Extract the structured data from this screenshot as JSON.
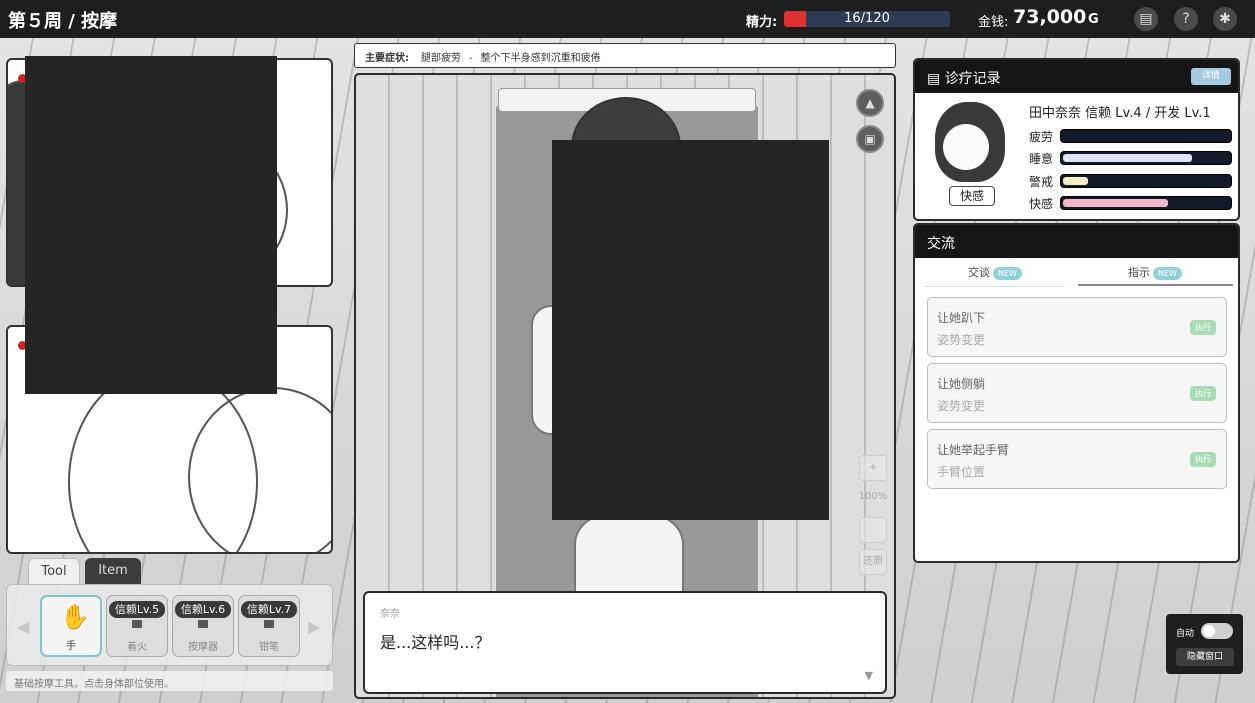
{
  "topbar": {
    "title": "第５周 / 按摩",
    "stamina_label": "精力:",
    "stamina_value": "16/120",
    "stamina_fraction": 0.133,
    "money_label": "金钱:",
    "money_value": "73,000",
    "money_unit": "G",
    "icons": [
      "chat-icon",
      "help-icon",
      "settings-icon"
    ]
  },
  "tools": {
    "tabs": [
      "Tool",
      "Item"
    ],
    "slots": [
      {
        "label": "手",
        "icon": "hand-icon",
        "locked": false
      },
      {
        "badge": "信赖Lv.5",
        "label": "着火",
        "locked": true
      },
      {
        "badge": "信赖Lv.6",
        "label": "按摩器",
        "locked": true
      },
      {
        "badge": "信赖Lv.7",
        "label": "钳笔",
        "locked": true
      }
    ],
    "hint": "基础按摩工具。点击身体部位使用。"
  },
  "symptom": {
    "label": "主要症状:",
    "part": "腿部疲劳",
    "separator": "-",
    "desc": "整个下半身感到沉重和疲倦"
  },
  "stage": {
    "zoom_plus": "+",
    "zoom_level": "100%",
    "zoom_reset": "还原"
  },
  "dialog": {
    "speaker": "奈奈",
    "text": "是...这样吗...？"
  },
  "record": {
    "title": "诊疗记录",
    "button": "详情",
    "name_line": "田中奈奈 信赖 Lv.4 / 开发 Lv.1",
    "tag": "快感",
    "stats": [
      {
        "label": "疲劳",
        "value": 0.0,
        "color": "#1a2236"
      },
      {
        "label": "睡意",
        "value": 0.78,
        "color": "#dde6f6"
      },
      {
        "label": "警戒",
        "value": 0.15,
        "color": "#f3edc8"
      },
      {
        "label": "快感",
        "value": 0.63,
        "color": "#f1b7c6"
      }
    ]
  },
  "comm": {
    "title": "交流",
    "tabs": [
      {
        "label": "交谈",
        "badge": "NEW"
      },
      {
        "label": "指示",
        "badge": "NEW"
      }
    ],
    "commands": [
      {
        "title": "让她趴下",
        "sub": "姿势变更",
        "action": "执行"
      },
      {
        "title": "让她侧躺",
        "sub": "姿势变更",
        "action": "执行"
      },
      {
        "title": "让她举起手臂",
        "sub": "手臂位置",
        "action": "执行"
      }
    ]
  },
  "auto": {
    "label": "自动",
    "hide": "隐藏窗口"
  }
}
